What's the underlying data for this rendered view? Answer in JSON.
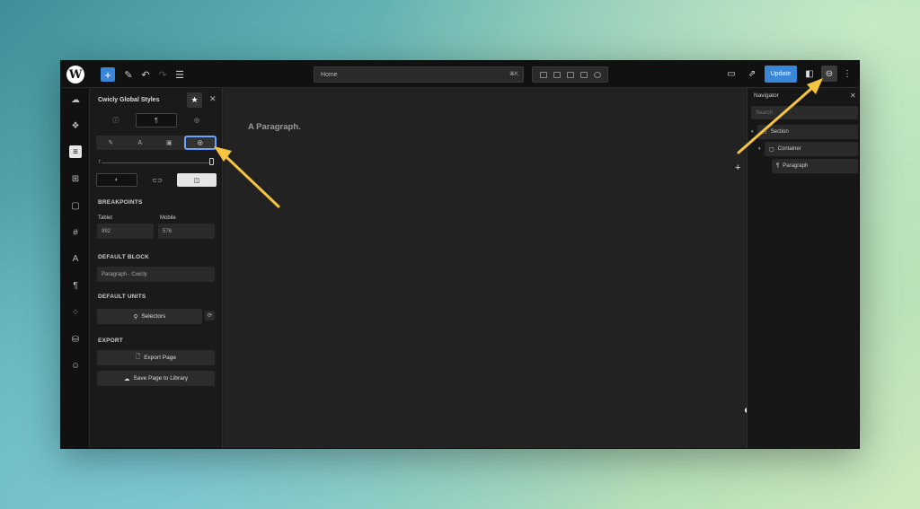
{
  "topbar": {
    "logo_letter": "W",
    "add_label": "+",
    "search_value": "Home",
    "search_shortcut": "⌘K",
    "update_label": "Update"
  },
  "rail": {
    "icons": [
      "cloud-icon",
      "components-icon",
      "global-styles-icon",
      "blocks-icon",
      "square-icon",
      "hash-icon",
      "typography-icon",
      "paragraph-icon",
      "variables-icon",
      "database-icon",
      "smiley-icon"
    ]
  },
  "panel": {
    "title": "Cwicly Global Styles",
    "breakpoints_label": "BREAKPOINTS",
    "tablet_label": "Tablet",
    "tablet_value": "992",
    "mobile_label": "Mobile",
    "mobile_value": "576",
    "default_block_label": "DEFAULT BLOCK",
    "default_block_value": "Paragraph - Cwicly",
    "default_units_label": "DEFAULT UNITS",
    "selectors_label": "Selectors",
    "export_label": "EXPORT",
    "export_page_label": "Export Page",
    "save_library_label": "Save Page to Library"
  },
  "canvas": {
    "paragraph_text": "A Paragraph."
  },
  "navigator": {
    "title": "Navigator",
    "search_placeholder": "Search",
    "items": [
      {
        "label": "Section"
      },
      {
        "label": "Container"
      },
      {
        "label": "Paragraph"
      }
    ]
  },
  "colors": {
    "accent": "#3a86d8",
    "arrow": "#f5c542",
    "active_tab_border": "#6aa0ff"
  }
}
